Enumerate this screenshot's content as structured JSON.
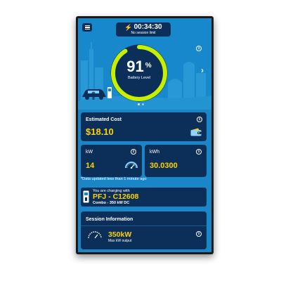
{
  "session": {
    "elapsed": "00:34:30",
    "limit_text": "No session limit"
  },
  "battery": {
    "percent": 91,
    "percent_number": "91",
    "percent_unit": "%",
    "label": "Battery Level"
  },
  "hero": {
    "info_glyph": "i",
    "next_glyph": "›",
    "carousel_pages": 2,
    "active_page": 1
  },
  "cost": {
    "title": "Estimated Cost",
    "value": "$18.10",
    "icon": "wallet-icon"
  },
  "power": {
    "title": "kW",
    "value": "14",
    "icon": "speedometer-icon"
  },
  "energy": {
    "title": "kWh",
    "value": "30.0300"
  },
  "update_note": "*Data updated less than 1 minute ago",
  "charger": {
    "label": "You are charging with",
    "name": "PFJ - C12608",
    "detail": "Combo - 350 kW DC"
  },
  "session_info": {
    "title": "Session Information",
    "value": "350kW",
    "sub": "Max kW output"
  },
  "colors": {
    "background_blue": "#1a86c8",
    "card_navy": "#0c2f5a",
    "accent_yellow": "#ffd200",
    "gauge_green": "#c6f000"
  }
}
